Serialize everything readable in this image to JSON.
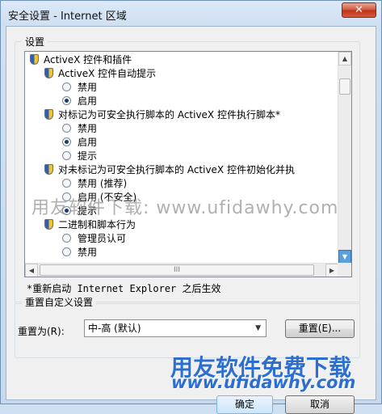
{
  "window": {
    "title": "安全设置 - Internet 区域",
    "close_label": "✕"
  },
  "settings_group": {
    "legend": "设置"
  },
  "tree": {
    "rows": [
      {
        "kind": "folder",
        "label": "ActiveX 控件和插件",
        "indent": 0
      },
      {
        "kind": "setting",
        "label": "ActiveX 控件自动提示",
        "indent": 1
      },
      {
        "kind": "option",
        "label": "禁用",
        "checked": false,
        "indent": 2
      },
      {
        "kind": "option",
        "label": "启用",
        "checked": true,
        "indent": 2
      },
      {
        "kind": "setting",
        "label": "对标记为可安全执行脚本的 ActiveX 控件执行脚本*",
        "indent": 1
      },
      {
        "kind": "option",
        "label": "禁用",
        "checked": false,
        "indent": 2
      },
      {
        "kind": "option",
        "label": "启用",
        "checked": true,
        "indent": 2
      },
      {
        "kind": "option",
        "label": "提示",
        "checked": false,
        "indent": 2
      },
      {
        "kind": "setting",
        "label": "对未标记为可安全执行脚本的 ActiveX 控件初始化并执",
        "indent": 1
      },
      {
        "kind": "option",
        "label": "禁用 (推荐)",
        "checked": false,
        "indent": 2
      },
      {
        "kind": "option",
        "label": "启用 (不安全)",
        "checked": false,
        "indent": 2
      },
      {
        "kind": "option",
        "label": "提示",
        "checked": true,
        "indent": 2
      },
      {
        "kind": "setting",
        "label": "二进制和脚本行为",
        "indent": 1
      },
      {
        "kind": "option",
        "label": "管理员认可",
        "checked": false,
        "indent": 2
      },
      {
        "kind": "option",
        "label": "禁用",
        "checked": false,
        "indent": 2
      }
    ],
    "hscroll_grip": "III"
  },
  "restart_note": "*重新启动 Internet Explorer 之后生效",
  "custom_reset": {
    "legend": "重置自定义设置",
    "label": "重置为(R):",
    "selected": "中-高 (默认)",
    "reset_button": "重置(E)..."
  },
  "watermark": "用友软件下载: www.ufidawhy.com",
  "brand": {
    "text": "用友软件免费下载",
    "url": "www.ufidawhy.com"
  },
  "footer": {
    "ok_label": "确定",
    "cancel_label": "取消"
  },
  "colors": {
    "accent": "#2d6fd0",
    "close": "#c8422a"
  }
}
